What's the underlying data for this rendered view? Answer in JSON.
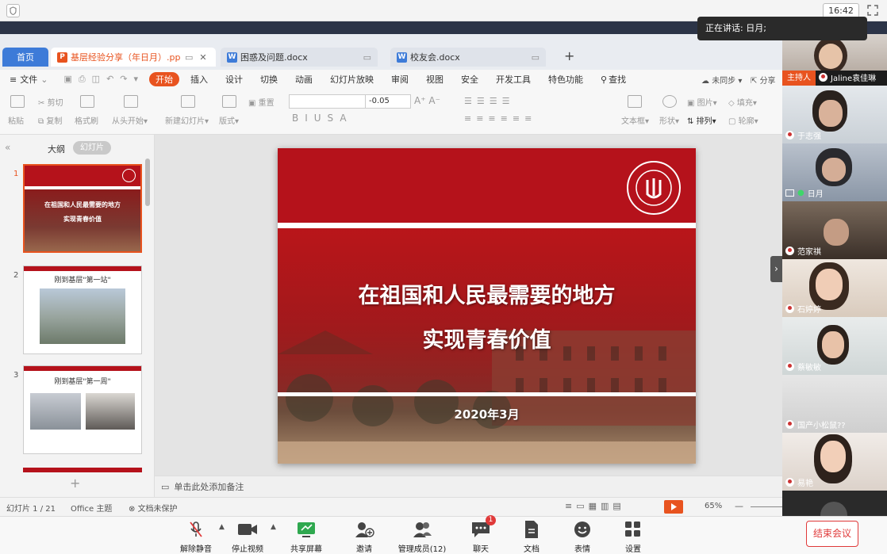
{
  "window": {
    "time": "16:42"
  },
  "speaker": {
    "label": "正在讲话: 日月;"
  },
  "tabs": [
    {
      "label": "首页",
      "active": false
    },
    {
      "label": "基层经验分享（年日月）.pptx",
      "active": true
    },
    {
      "label": "困惑及问题.docx",
      "active": false
    },
    {
      "label": "校友会.docx",
      "active": false
    }
  ],
  "menu": {
    "file": "文件",
    "items": [
      "开始",
      "插入",
      "设计",
      "切换",
      "动画",
      "幻灯片放映",
      "审阅",
      "视图",
      "安全",
      "开发工具",
      "特色功能"
    ],
    "search": "查找",
    "sync": "未同步",
    "share": "分享"
  },
  "ribbon": {
    "paste": "粘贴",
    "cut": "剪切",
    "copy": "复制",
    "format_painter": "格式刷",
    "from_start": "从头开始",
    "new_slide": "新建幻灯片",
    "layout": "版式",
    "reset": "重置",
    "font_size": "-0.05",
    "textbox": "文本框",
    "shape": "形状",
    "arrange": "排列",
    "picture": "图片",
    "fill": "填充",
    "outline": "轮廓"
  },
  "leftpanel": {
    "outline_tab": "大纲",
    "slides_tab": "幻灯片"
  },
  "thumbs": [
    {
      "num": "1",
      "title1": "在祖国和人民最需要的地方",
      "title2": "实现青春价值"
    },
    {
      "num": "2",
      "title": "刚到基层\"第一站\""
    },
    {
      "num": "3",
      "title": "刚到基层\"第一周\""
    }
  ],
  "slide": {
    "title1": "在祖国和人民最需要的地方",
    "title2": "实现青春价值",
    "date": "2020年3月"
  },
  "notes": {
    "placeholder": "单击此处添加备注"
  },
  "status": {
    "slide_count": "幻灯片 1 / 21",
    "theme": "Office 主题",
    "protect": "文档未保护",
    "zoom": "65%"
  },
  "participants": [
    {
      "name": "Jaline袁佳琳",
      "host_badge": "主持人"
    },
    {
      "name": "于志强"
    },
    {
      "name": "日月"
    },
    {
      "name": "范家祺"
    },
    {
      "name": "石婷婷"
    },
    {
      "name": "蔡敏敏"
    },
    {
      "name": "国产小松鼠??"
    },
    {
      "name": "易艳"
    }
  ],
  "bottombar": {
    "unmute": "解除静音",
    "stop_video": "停止视频",
    "share_screen": "共享屏幕",
    "invite": "邀请",
    "manage": "管理成员(12)",
    "chat": "聊天",
    "chat_badge": "1",
    "docs": "文档",
    "emoji": "表情",
    "settings": "设置",
    "end": "结束会议"
  },
  "colors": {
    "accent": "#e8531f",
    "end_red": "#e03a3a",
    "slide_red": "#b5121b"
  }
}
